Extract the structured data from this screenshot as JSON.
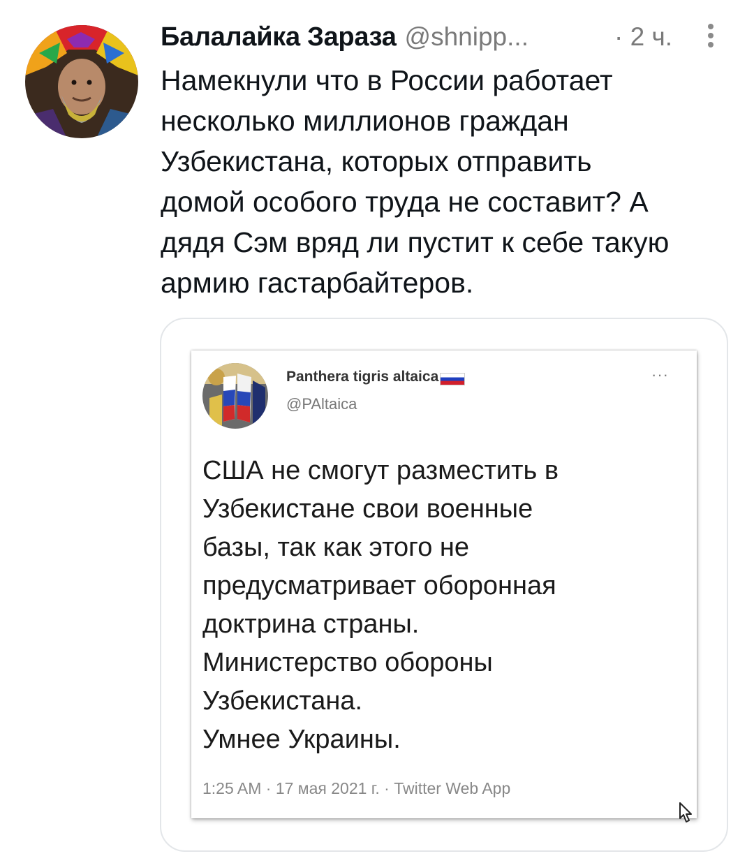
{
  "tweet": {
    "author_name": "Балалайка Зараза",
    "author_handle": "@shnipp...",
    "time": "· 2 ч.",
    "more_icon": "more-vertical-icon",
    "text": "Намекнули что в России работает\nнесколько миллионов граждан\nУзбекистана, которых отправить\nдомой особого труда не составит? А\nдядя Сэм вряд ли пустит к себе такую\nармию гастарбайтеров."
  },
  "embedded": {
    "author_name": "Panthera tigris altaica",
    "author_handle": "@PAltaica",
    "more_label": "···",
    "text": "США не смогут разместить в\nУзбекистане свои военные\nбазы, так как этого не\nпредусматривает оборонная\nдоктрина страны.\nМинистерство обороны\nУзбекистана.\nУмнее Украины.",
    "meta": "1:25 AM · 17 мая 2021 г. · Twitter Web App"
  },
  "colors": {
    "text": "#0f1419",
    "secondary": "#7a7a7a",
    "card_border": "#e3e6e9"
  }
}
